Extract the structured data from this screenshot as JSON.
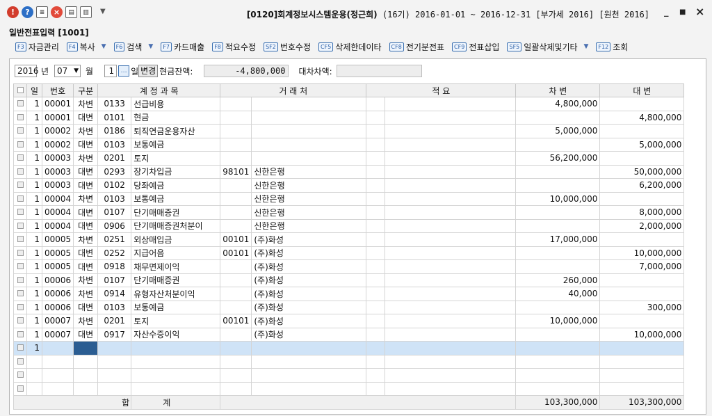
{
  "window": {
    "title_code": "[0120]",
    "title_name": "회계정보시스템운용(정근희)",
    "title_meta": "(16기) 2016-01-01 ~ 2016-12-31 [부가세 2016] [원천 2016]",
    "min": "_",
    "max": "■",
    "close": "×"
  },
  "screen_title": "일반전표입력 [1001]",
  "toolbar": [
    {
      "key": "F3",
      "label": "자금관리",
      "dropdown": false
    },
    {
      "key": "F4",
      "label": "복사",
      "dropdown": true
    },
    {
      "key": "F6",
      "label": "검색",
      "dropdown": true
    },
    {
      "key": "F7",
      "label": "카드매출",
      "dropdown": false
    },
    {
      "key": "F8",
      "label": "적요수정",
      "dropdown": false
    },
    {
      "key": "SF2",
      "label": "번호수정",
      "dropdown": false
    },
    {
      "key": "CF5",
      "label": "삭제한데이타",
      "dropdown": false
    },
    {
      "key": "CF8",
      "label": "전기분전표",
      "dropdown": false
    },
    {
      "key": "CF9",
      "label": "전표삽입",
      "dropdown": false
    },
    {
      "key": "SF5",
      "label": "일괄삭제및기타",
      "dropdown": true
    },
    {
      "key": "F12",
      "label": "조회",
      "dropdown": false
    }
  ],
  "filter": {
    "year": "2016",
    "year_label": "년",
    "month": "07",
    "month_label": "월",
    "day": "1",
    "day_label": "일",
    "change_button": "변경",
    "cash_label": "현금잔액:",
    "cash_value": "-4,800,000",
    "diff_label": "대차차액:",
    "diff_value": ""
  },
  "grid": {
    "headers": [
      "일",
      "번호",
      "구분",
      "계 정 과 목",
      "거 래 처",
      "적 요",
      "차 변",
      "대 변"
    ],
    "rows": [
      {
        "day": "1",
        "no": "00001",
        "type": "차변",
        "acode": "0133",
        "aname": "선급비용",
        "pcode": "",
        "pname": "",
        "memo": "",
        "debit": "4,800,000",
        "credit": ""
      },
      {
        "day": "1",
        "no": "00001",
        "type": "대변",
        "acode": "0101",
        "aname": "현금",
        "pcode": "",
        "pname": "",
        "memo": "",
        "debit": "",
        "credit": "4,800,000"
      },
      {
        "day": "1",
        "no": "00002",
        "type": "차변",
        "acode": "0186",
        "aname": "퇴직연금운용자산",
        "pcode": "",
        "pname": "",
        "memo": "",
        "debit": "5,000,000",
        "credit": ""
      },
      {
        "day": "1",
        "no": "00002",
        "type": "대변",
        "acode": "0103",
        "aname": "보통예금",
        "pcode": "",
        "pname": "",
        "memo": "",
        "debit": "",
        "credit": "5,000,000"
      },
      {
        "day": "1",
        "no": "00003",
        "type": "차변",
        "acode": "0201",
        "aname": "토지",
        "pcode": "",
        "pname": "",
        "memo": "",
        "debit": "56,200,000",
        "credit": ""
      },
      {
        "day": "1",
        "no": "00003",
        "type": "대변",
        "acode": "0293",
        "aname": "장기차입금",
        "pcode": "98101",
        "pname": "신한은행",
        "memo": "",
        "debit": "",
        "credit": "50,000,000"
      },
      {
        "day": "1",
        "no": "00003",
        "type": "대변",
        "acode": "0102",
        "aname": "당좌예금",
        "pcode": "",
        "pname": "신한은행",
        "memo": "",
        "debit": "",
        "credit": "6,200,000"
      },
      {
        "day": "1",
        "no": "00004",
        "type": "차변",
        "acode": "0103",
        "aname": "보통예금",
        "pcode": "",
        "pname": "신한은행",
        "memo": "",
        "debit": "10,000,000",
        "credit": ""
      },
      {
        "day": "1",
        "no": "00004",
        "type": "대변",
        "acode": "0107",
        "aname": "단기매매증권",
        "pcode": "",
        "pname": "신한은행",
        "memo": "",
        "debit": "",
        "credit": "8,000,000"
      },
      {
        "day": "1",
        "no": "00004",
        "type": "대변",
        "acode": "0906",
        "aname": "단기매매증권처분이",
        "pcode": "",
        "pname": "신한은행",
        "memo": "",
        "debit": "",
        "credit": "2,000,000"
      },
      {
        "day": "1",
        "no": "00005",
        "type": "차변",
        "acode": "0251",
        "aname": "외상매입금",
        "pcode": "00101",
        "pname": "(주)화성",
        "memo": "",
        "debit": "17,000,000",
        "credit": ""
      },
      {
        "day": "1",
        "no": "00005",
        "type": "대변",
        "acode": "0252",
        "aname": "지급어음",
        "pcode": "00101",
        "pname": "(주)화성",
        "memo": "",
        "debit": "",
        "credit": "10,000,000"
      },
      {
        "day": "1",
        "no": "00005",
        "type": "대변",
        "acode": "0918",
        "aname": "채무면제이익",
        "pcode": "",
        "pname": "(주)화성",
        "memo": "",
        "debit": "",
        "credit": "7,000,000"
      },
      {
        "day": "1",
        "no": "00006",
        "type": "차변",
        "acode": "0107",
        "aname": "단기매매증권",
        "pcode": "",
        "pname": "(주)화성",
        "memo": "",
        "debit": "260,000",
        "credit": ""
      },
      {
        "day": "1",
        "no": "00006",
        "type": "차변",
        "acode": "0914",
        "aname": "유형자산처분이익",
        "pcode": "",
        "pname": "(주)화성",
        "memo": "",
        "debit": "40,000",
        "credit": ""
      },
      {
        "day": "1",
        "no": "00006",
        "type": "대변",
        "acode": "0103",
        "aname": "보통예금",
        "pcode": "",
        "pname": "(주)화성",
        "memo": "",
        "debit": "",
        "credit": "300,000"
      },
      {
        "day": "1",
        "no": "00007",
        "type": "차변",
        "acode": "0201",
        "aname": "토지",
        "pcode": "00101",
        "pname": "(주)화성",
        "memo": "",
        "debit": "10,000,000",
        "credit": ""
      },
      {
        "day": "1",
        "no": "00007",
        "type": "대변",
        "acode": "0917",
        "aname": "자산수증이익",
        "pcode": "",
        "pname": "(주)화성",
        "memo": "",
        "debit": "",
        "credit": "10,000,000"
      }
    ],
    "current_row_day": "1",
    "sum_label_1": "합",
    "sum_label_2": "계",
    "total_debit": "103,300,000",
    "total_credit": "103,300,000"
  }
}
